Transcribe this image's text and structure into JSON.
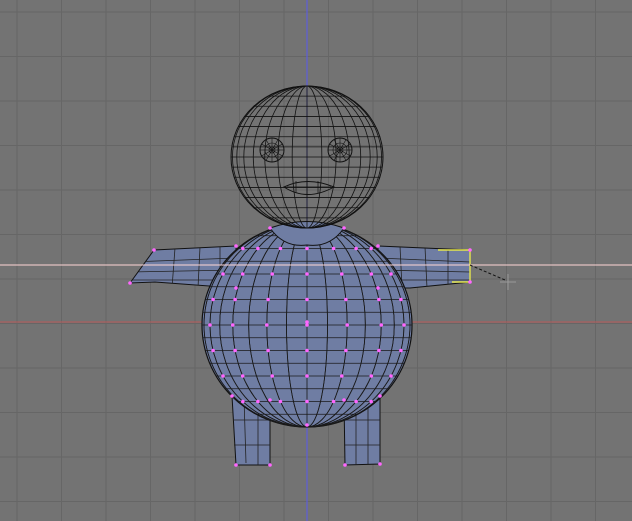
{
  "viewport": {
    "view": "front-orthographic",
    "mode": "edit",
    "background_color": "#737373",
    "grid_color": "#666666",
    "axis_vertical_color": "#5555ee",
    "axis_horizontal_color": "#b55a5a",
    "constraint_line_color": "#ffd0d0"
  },
  "mesh": {
    "face_color": "#6f7da3",
    "wire_color": "#111111",
    "selected_vertex_color": "#ff66ff",
    "active_edge_color": "#e6e64d"
  },
  "cursor": {
    "icon": "crosshair-icon",
    "line_style": "dashed"
  }
}
